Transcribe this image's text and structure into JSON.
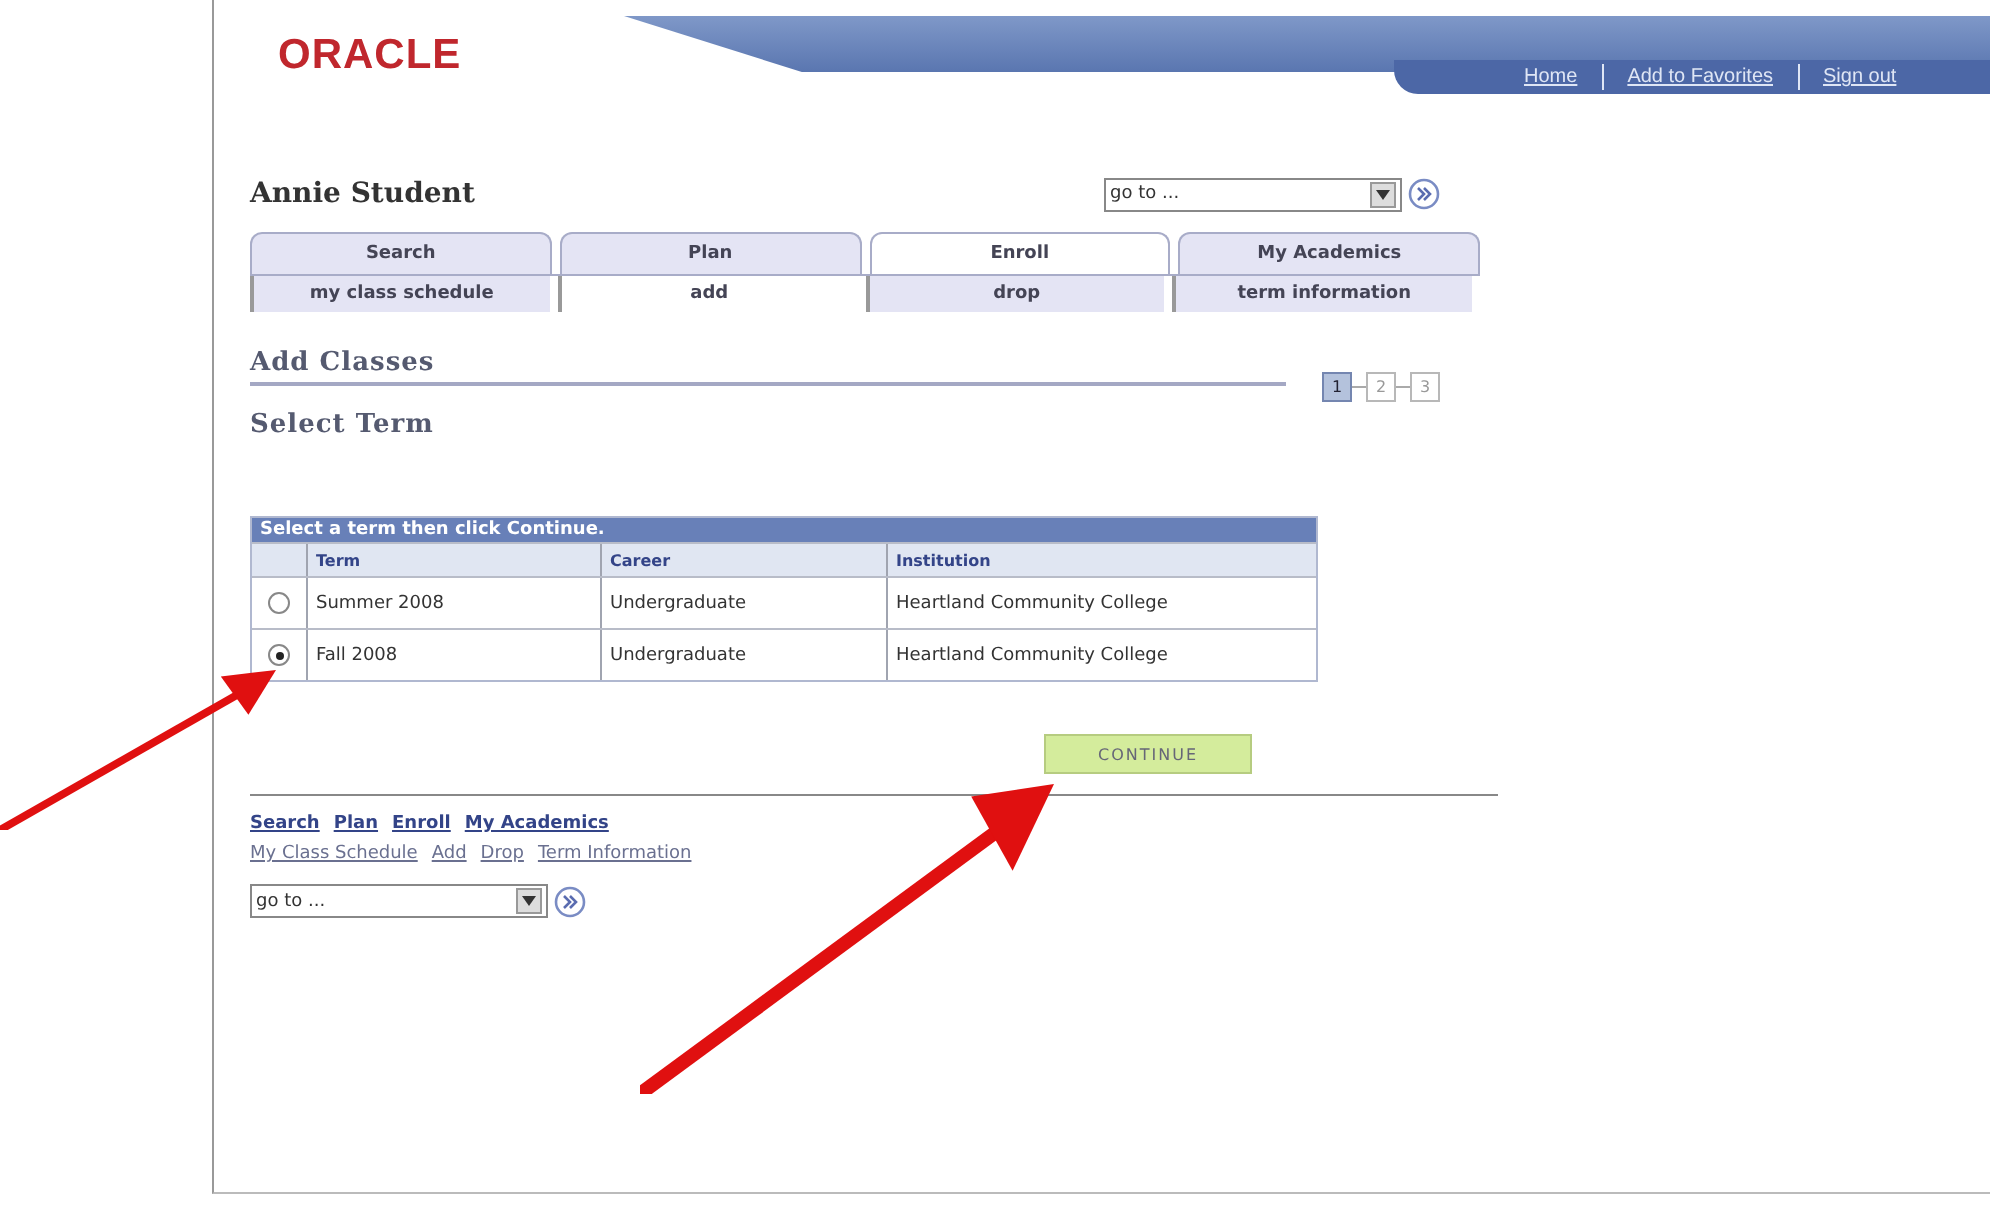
{
  "header": {
    "logo": "ORACLE",
    "nav": [
      "Home",
      "Add to Favorites",
      "Sign out"
    ]
  },
  "user_name": "Annie Student",
  "top_goto": {
    "value": "go to ..."
  },
  "tabs": [
    {
      "label": "Search",
      "selected": false
    },
    {
      "label": "Plan",
      "selected": false
    },
    {
      "label": "Enroll",
      "selected": true
    },
    {
      "label": "My Academics",
      "selected": false
    }
  ],
  "subtabs": [
    {
      "label": "my class schedule",
      "selected": false
    },
    {
      "label": "add",
      "selected": true
    },
    {
      "label": "drop",
      "selected": false
    },
    {
      "label": "term information",
      "selected": false
    }
  ],
  "page_title": "Add Classes",
  "steps": [
    {
      "label": "1",
      "selected": true
    },
    {
      "label": "2",
      "selected": false
    },
    {
      "label": "3",
      "selected": false
    }
  ],
  "section_title": "Select Term",
  "table": {
    "title": "Select a term then click Continue.",
    "columns": [
      "Term",
      "Career",
      "Institution"
    ],
    "rows": [
      {
        "selected": false,
        "cells": [
          "Summer 2008",
          "Undergraduate",
          "Heartland Community College"
        ]
      },
      {
        "selected": true,
        "cells": [
          "Fall 2008",
          "Undergraduate",
          "Heartland Community College"
        ]
      }
    ]
  },
  "continue_button": "CONTINUE",
  "footer_links": [
    [
      "Search",
      "Plan",
      "Enroll",
      "My Academics"
    ],
    [
      "My Class Schedule",
      "Add",
      "Drop",
      "Term Information"
    ]
  ],
  "bottom_goto": {
    "value": "go to ..."
  },
  "annotations": [
    {
      "kind": "arrow"
    },
    {
      "kind": "arrow"
    }
  ]
}
